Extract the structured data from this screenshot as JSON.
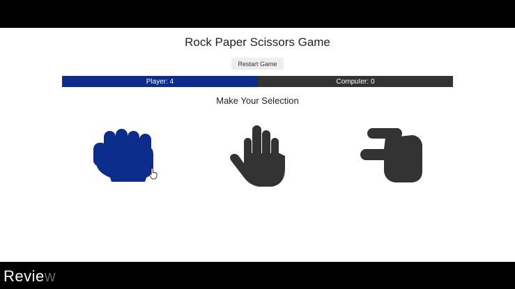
{
  "header": {
    "title": "Rock Paper Scissors Game",
    "restart_label": "Restart Game"
  },
  "score": {
    "player_label": "Player: 4",
    "computer_label": "Computer: 0",
    "player_color": "#0d2d8c",
    "computer_color": "#333333"
  },
  "selection": {
    "prompt": "Make Your Selection",
    "choices": [
      {
        "name": "rock",
        "icon": "hand-rock-icon",
        "color": "#0d2d8c",
        "state": "hovered"
      },
      {
        "name": "paper",
        "icon": "hand-paper-icon",
        "color": "#333333"
      },
      {
        "name": "scissors",
        "icon": "hand-scissors-icon",
        "color": "#333333"
      }
    ]
  },
  "watermark": {
    "text_main": "Revie",
    "text_faded": "w"
  }
}
